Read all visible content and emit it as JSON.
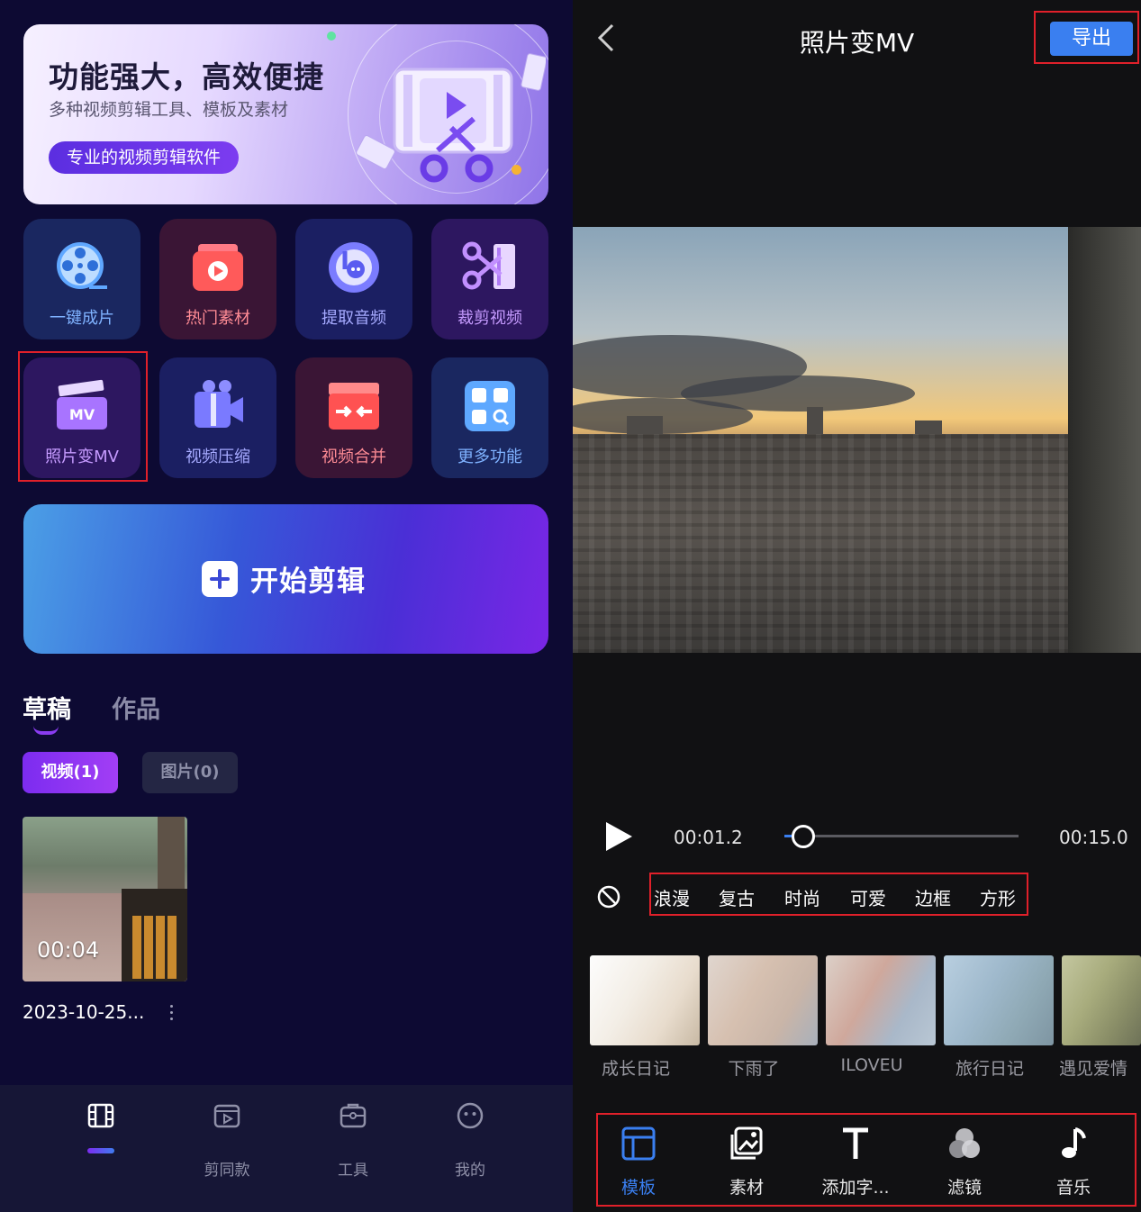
{
  "left": {
    "banner": {
      "title": "功能强大，高效便捷",
      "subtitle": "多种视频剪辑工具、模板及素材",
      "pill": "专业的视频剪辑软件"
    },
    "tools": [
      {
        "label": "一键成片",
        "icon": "film-reel-icon"
      },
      {
        "label": "热门素材",
        "icon": "play-stack-icon"
      },
      {
        "label": "提取音频",
        "icon": "audio-extract-icon"
      },
      {
        "label": "裁剪视频",
        "icon": "scissors-film-icon"
      },
      {
        "label": "照片变MV",
        "icon": "mv-clapper-icon"
      },
      {
        "label": "视频压缩",
        "icon": "video-compress-icon"
      },
      {
        "label": "视频合并",
        "icon": "video-merge-icon"
      },
      {
        "label": "更多功能",
        "icon": "more-grid-icon"
      }
    ],
    "start_button": "开始剪辑",
    "tabs": {
      "drafts": "草稿",
      "works": "作品"
    },
    "chips": {
      "video": "视频(1)",
      "photo": "图片(0)"
    },
    "draft": {
      "duration": "00:04",
      "date": "2023-10-25..."
    },
    "nav": [
      {
        "label": "",
        "icon": "film-icon"
      },
      {
        "label": "剪同款",
        "icon": "template-play-icon"
      },
      {
        "label": "工具",
        "icon": "toolbox-icon"
      },
      {
        "label": "我的",
        "icon": "profile-face-icon"
      }
    ],
    "colors": {
      "accent": "#7c2cf0",
      "highlight": "#e0202a"
    }
  },
  "right": {
    "title": "照片变MV",
    "export": "导出",
    "player": {
      "current": "00:01.2",
      "total": "00:15.0",
      "progress": 0.08
    },
    "categories": [
      "浪漫",
      "复古",
      "时尚",
      "可爱",
      "边框",
      "方形"
    ],
    "templates": [
      "成长日记",
      "下雨了",
      "ILOVEU",
      "旅行日记",
      "遇见爱情"
    ],
    "nav": [
      {
        "label": "模板",
        "icon": "template-layout-icon",
        "active": true
      },
      {
        "label": "素材",
        "icon": "gallery-icon",
        "active": false
      },
      {
        "label": "添加字...",
        "icon": "text-icon",
        "active": false
      },
      {
        "label": "滤镜",
        "icon": "filter-icon",
        "active": false
      },
      {
        "label": "音乐",
        "icon": "music-note-icon",
        "active": false
      }
    ],
    "colors": {
      "primary": "#3a7ff0"
    }
  }
}
